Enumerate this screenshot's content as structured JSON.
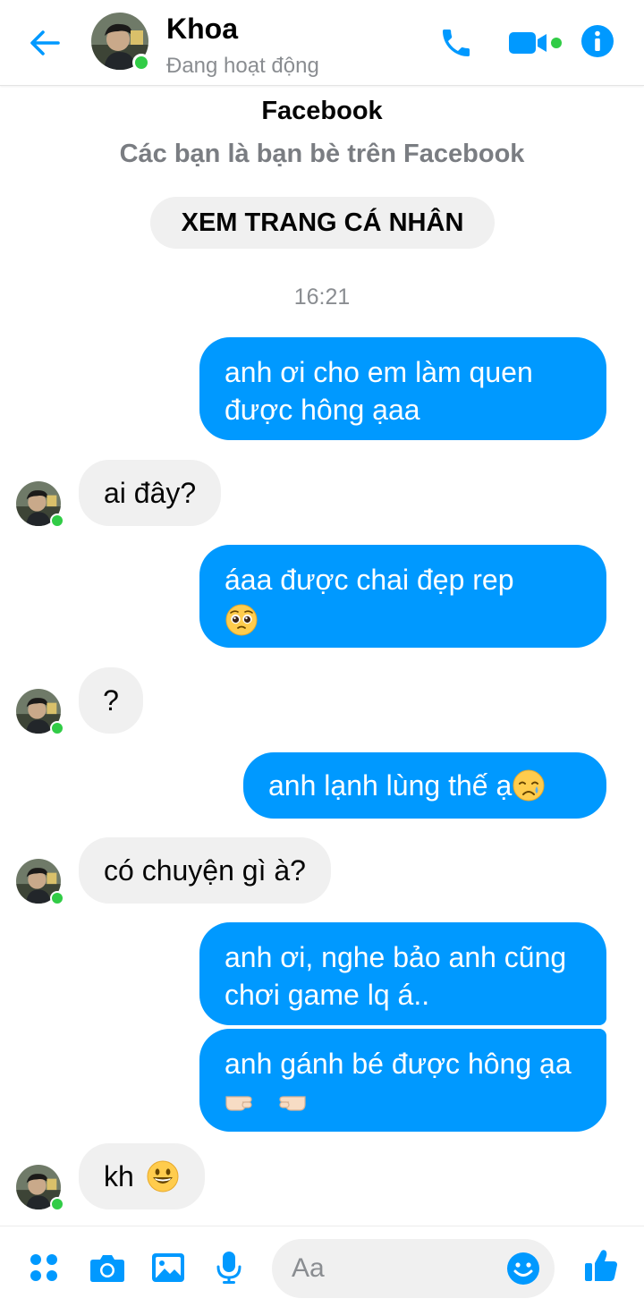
{
  "header": {
    "name": "Khoa",
    "status": "Đang hoạt động"
  },
  "intro": {
    "title": "Facebook",
    "subtitle": "Các bạn là bạn bè trên Facebook",
    "profile_button": "XEM TRANG CÁ NHÂN"
  },
  "timestamp": "16:21",
  "messages": [
    {
      "from": "me",
      "text": "anh ơi cho em làm quen được hông ạaa"
    },
    {
      "from": "them",
      "text": "ai đây?"
    },
    {
      "from": "me",
      "text": "áaa được chai đẹp rep",
      "emoji": "pleading-face"
    },
    {
      "from": "them",
      "text": "?"
    },
    {
      "from": "me",
      "text": "anh lạnh lùng thế ạ",
      "emoji": "crying-face"
    },
    {
      "from": "them",
      "text": "có chuyện gì à?"
    },
    {
      "from": "me",
      "text": "anh ơi, nghe bảo anh cũng chơi game lq á.."
    },
    {
      "from": "me",
      "text": "anh gánh bé được hông ạa",
      "emoji": "pointing-fingers"
    },
    {
      "from": "them",
      "text": "kh",
      "emoji": "grinning-face"
    }
  ],
  "composer": {
    "placeholder": "Aa"
  },
  "colors": {
    "accent": "#0099ff",
    "online": "#31cc46",
    "incoming_bubble": "#f0f0f0"
  }
}
